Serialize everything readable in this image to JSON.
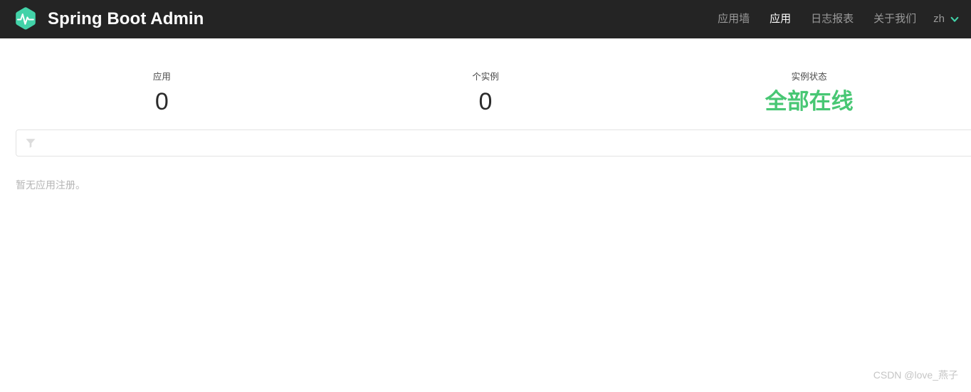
{
  "brand": {
    "title": "Spring Boot Admin",
    "logo_icon": "heartbeat-hexagon-icon"
  },
  "nav": {
    "items": [
      {
        "label": "应用墙",
        "active": false
      },
      {
        "label": "应用",
        "active": true
      },
      {
        "label": "日志报表",
        "active": false
      },
      {
        "label": "关于我们",
        "active": false
      }
    ],
    "language": {
      "label": "zh",
      "chevron_icon": "chevron-down-icon"
    }
  },
  "stats": [
    {
      "label": "应用",
      "value": "0",
      "status": false
    },
    {
      "label": "个实例",
      "value": "0",
      "status": false
    },
    {
      "label": "实例状态",
      "value": "全部在线",
      "status": true
    }
  ],
  "filter": {
    "icon": "filter-funnel-icon",
    "value": "",
    "placeholder": ""
  },
  "empty_state": {
    "message": "暂无应用注册。"
  },
  "watermark": {
    "text": "CSDN @love_燕子"
  },
  "colors": {
    "navbar_background": "#242424",
    "accent_green": "#48c774",
    "nav_inactive": "#9a9a9a",
    "nav_active": "#ffffff",
    "stat_value": "#2b2b2b",
    "muted_text": "#b5b5b5",
    "input_border": "#e3e3e3"
  }
}
